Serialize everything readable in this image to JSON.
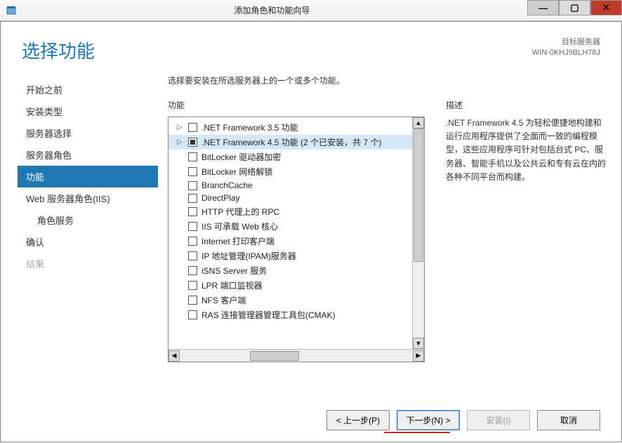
{
  "window": {
    "title": "添加角色和功能向导"
  },
  "header": {
    "page_title": "选择功能",
    "target_label": "目标服务器",
    "target_name": "WIN-0KHJ9BLH78J"
  },
  "sidebar": {
    "items": [
      {
        "label": "开始之前",
        "state": "normal"
      },
      {
        "label": "安装类型",
        "state": "normal"
      },
      {
        "label": "服务器选择",
        "state": "normal"
      },
      {
        "label": "服务器角色",
        "state": "normal"
      },
      {
        "label": "功能",
        "state": "selected"
      },
      {
        "label": "Web 服务器角色(IIS)",
        "state": "normal"
      },
      {
        "label": "角色服务",
        "state": "normal",
        "sub": true
      },
      {
        "label": "确认",
        "state": "normal"
      },
      {
        "label": "结果",
        "state": "disabled"
      }
    ]
  },
  "main": {
    "instruction": "选择要安装在所选服务器上的一个或多个功能。",
    "features_label": "功能",
    "description_label": "描述",
    "description_text": ".NET Framework 4.5 为轻松便捷地构建和运行应用程序提供了全面而一致的编程模型，这些应用程序可针对包括台式 PC、服务器、智能手机以及公共云和专有云在内的各种不同平台而构建。"
  },
  "features": [
    {
      "label": ".NET Framework 3.5 功能",
      "check": "unchecked",
      "expander": "▷"
    },
    {
      "label": ".NET Framework 4.5 功能 (2 个已安装，共 7 个)",
      "check": "indeterminate",
      "expander": "▷",
      "highlight": true
    },
    {
      "label": "BitLocker 驱动器加密",
      "check": "unchecked"
    },
    {
      "label": "BitLocker 网络解锁",
      "check": "unchecked"
    },
    {
      "label": "BranchCache",
      "check": "unchecked"
    },
    {
      "label": "DirectPlay",
      "check": "unchecked"
    },
    {
      "label": "HTTP 代理上的 RPC",
      "check": "unchecked"
    },
    {
      "label": "IIS 可承载 Web 核心",
      "check": "unchecked"
    },
    {
      "label": "Internet 打印客户端",
      "check": "unchecked"
    },
    {
      "label": "IP 地址管理(IPAM)服务器",
      "check": "unchecked"
    },
    {
      "label": "iSNS Server 服务",
      "check": "unchecked"
    },
    {
      "label": "LPR 端口监视器",
      "check": "unchecked"
    },
    {
      "label": "NFS 客户端",
      "check": "unchecked"
    },
    {
      "label": "RAS 连接管理器管理工具包(CMAK)",
      "check": "unchecked"
    }
  ],
  "footer": {
    "previous": "< 上一步(P)",
    "next": "下一步(N) >",
    "install": "安装(I)",
    "cancel": "取消"
  }
}
